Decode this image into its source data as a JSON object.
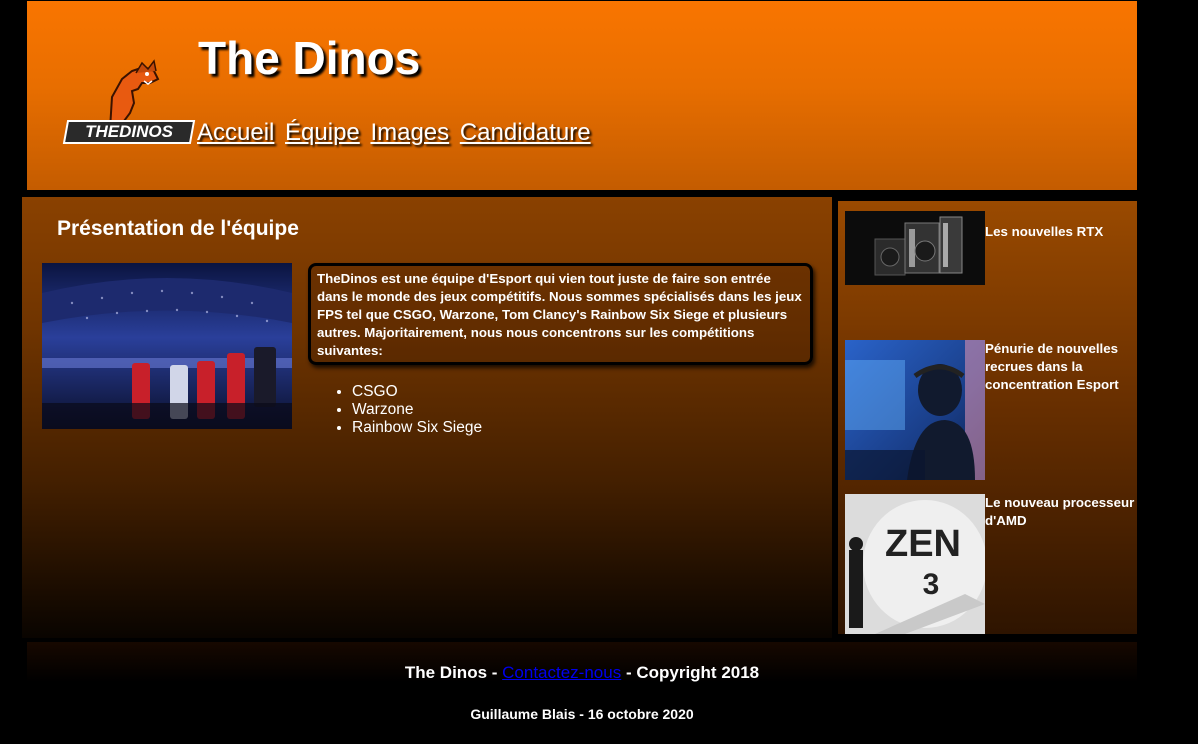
{
  "header": {
    "title": "The Dinos",
    "logo_text": "THEDINOS",
    "nav": [
      {
        "label": "Accueil"
      },
      {
        "label": "Équipe"
      },
      {
        "label": "Images"
      },
      {
        "label": "Candidature"
      }
    ]
  },
  "main": {
    "title": "Présentation de l'équipe",
    "intro": "TheDinos est une équipe d'Esport qui vien tout juste de faire son entrée dans le monde des jeux compétitifs. Nous sommes spécialisés dans les jeux FPS tel que CSGO, Warzone, Tom Clancy's Rainbow Six Siege et plusieurs autres. Majoritairement, nous nous concentrons sur les compétitions suivantes:",
    "games": [
      "CSGO",
      "Warzone",
      "Rainbow Six Siege"
    ]
  },
  "sidebar": {
    "news": [
      {
        "title": "Les nouvelles RTX"
      },
      {
        "title": "Pénurie de nouvelles recrues dans la concentration Esport"
      },
      {
        "title": "Le nouveau processeur d'AMD"
      }
    ],
    "amd_image_text": [
      "ZEN",
      "3"
    ]
  },
  "footer": {
    "prefix": "The Dinos - ",
    "contact_link": "Contactez-nous",
    "suffix": " - Copyright 2018",
    "credit": "Guillaume Blais - 16 octobre 2020"
  },
  "colors": {
    "header_orange": "#f97500",
    "link_blue": "#0000ee",
    "background": "#000000"
  }
}
